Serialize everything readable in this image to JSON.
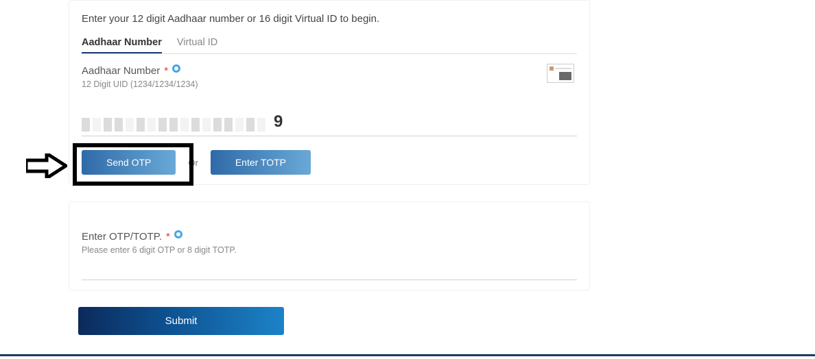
{
  "intro": "Enter your 12 digit Aadhaar number or 16 digit Virtual ID to begin.",
  "tabs": {
    "aadhaar": "Aadhaar Number",
    "virtual": "Virtual ID"
  },
  "aadhaar_field": {
    "label": "Aadhaar Number",
    "required_mark": "*",
    "sub": "12 Digit UID (1234/1234/1234)",
    "visible_digit": "9"
  },
  "buttons": {
    "send_otp": "Send OTP",
    "or": "Or",
    "enter_totp": "Enter TOTP",
    "submit": "Submit"
  },
  "otp_field": {
    "label": "Enter OTP/TOTP.",
    "required_mark": "*",
    "sub": "Please enter 6 digit OTP or 8 digit TOTP."
  }
}
